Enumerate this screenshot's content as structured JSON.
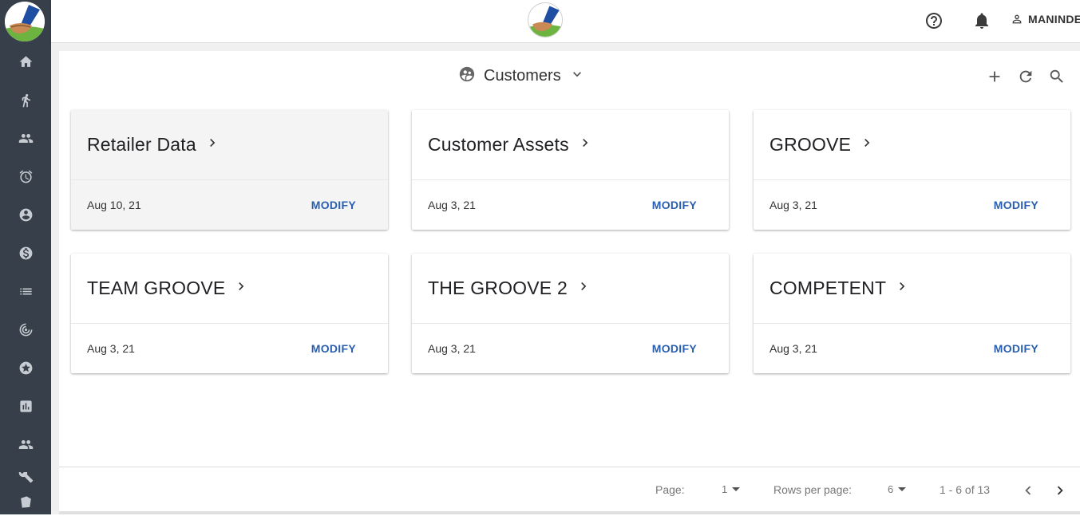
{
  "header": {
    "user_name": "MANINDER",
    "icons": [
      "help-circle-icon",
      "bell-icon",
      "user-outline-icon"
    ]
  },
  "sidebar": {
    "items": [
      {
        "icon": "home-icon"
      },
      {
        "icon": "running-person-icon"
      },
      {
        "icon": "people-icon"
      },
      {
        "icon": "alarm-clock-icon"
      },
      {
        "icon": "account-circle-icon"
      },
      {
        "icon": "dollar-circle-icon"
      },
      {
        "icon": "list-icon"
      },
      {
        "icon": "target-icon"
      },
      {
        "icon": "star-badge-icon"
      },
      {
        "icon": "bar-chart-icon"
      },
      {
        "icon": "group-icon"
      },
      {
        "icon": "build-icon"
      },
      {
        "icon": "box-icon"
      }
    ]
  },
  "page": {
    "title": "Customers",
    "actions": [
      "add-icon",
      "refresh-icon",
      "search-icon"
    ]
  },
  "cards": [
    {
      "title": "Retailer Data",
      "date": "Aug 10, 21",
      "action": "MODIFY"
    },
    {
      "title": "Customer Assets",
      "date": "Aug 3, 21",
      "action": "MODIFY"
    },
    {
      "title": "GROOVE",
      "date": "Aug 3, 21",
      "action": "MODIFY"
    },
    {
      "title": "TEAM GROOVE",
      "date": "Aug 3, 21",
      "action": "MODIFY"
    },
    {
      "title": "THE GROOVE 2",
      "date": "Aug 3, 21",
      "action": "MODIFY"
    },
    {
      "title": "COMPETENT",
      "date": "Aug 3, 21",
      "action": "MODIFY"
    }
  ],
  "pagination": {
    "page_label": "Page:",
    "page_value": "1",
    "rows_label": "Rows per page:",
    "rows_value": "6",
    "range": "1 - 6 of 13"
  },
  "colors": {
    "sidebar_bg": "#37404a",
    "accent_link": "#2a5fb0"
  }
}
